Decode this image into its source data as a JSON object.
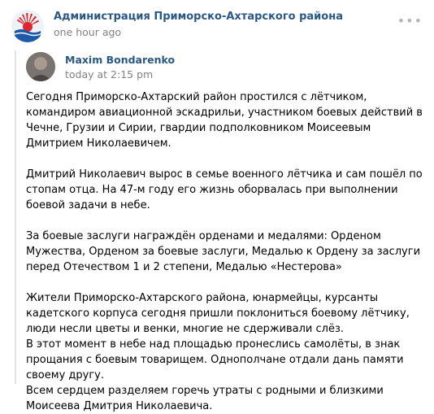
{
  "post": {
    "author": "Администрация Приморско-Ахтарского района",
    "time": "one hour ago",
    "more_icon": "more-dots-icon"
  },
  "repost": {
    "author": "Maxim Bondarenko",
    "time": "today at 2:15 pm",
    "paragraphs": [
      "Сегодня Приморско-Ахтарский район простился с лётчиком, командиром авиационной эскадрильи, участником боевых действий в Чечне, Грузии и Сирии, гвардии подполковником Моисеевым Дмитрием Николаевичем.",
      "Дмитрий Николаевич вырос в семье военного лётчика и сам пошёл по стопам отца. На 47-м году его жизнь оборвалась при выполнении боевой задачи в небе.",
      "За боевые заслуги награждён орденами и медалями: Орденом Мужества, Орденом за боевые заслуги, Медалью к Ордену за заслуги перед Отечеством 1 и 2 степени, Медалью «Нестерова»",
      "Жители Приморско-Ахтарского района, юнармейцы, курсанты кадетского корпуса сегодня пришли поклониться боевому лётчику, люди несли цветы и венки, многие не сдерживали слёз.",
      "В этот момент в небе над площадью пронеслись самолёты, в знак прощания с боевым товарищем. Однополчане отдали дань памяти своему другу.",
      "Всем сердцем разделяем горечь утраты с родными и близкими Моисеева Дмитрия Николаевича."
    ]
  },
  "colors": {
    "link": "#2a5885",
    "meta": "#828282",
    "accent_red": "#e0252e",
    "accent_blue": "#1e5aa8"
  }
}
